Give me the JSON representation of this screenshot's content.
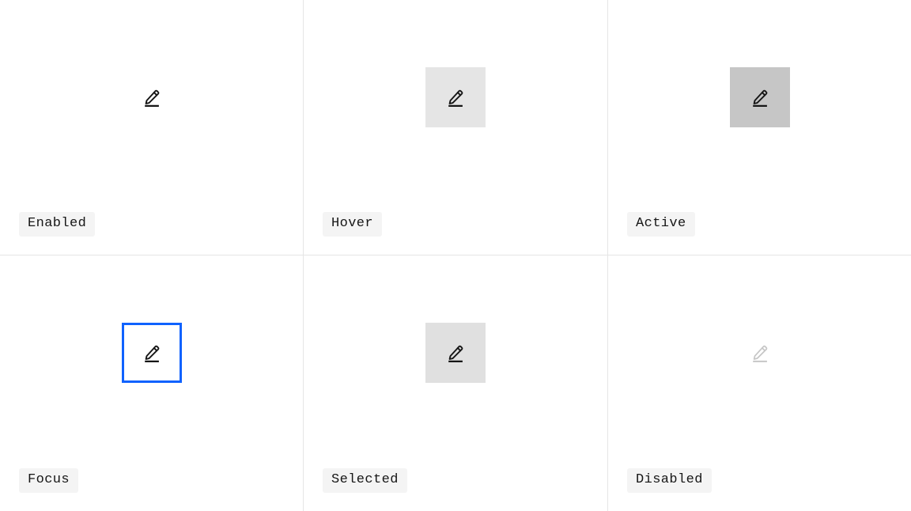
{
  "page": {
    "title": "Icon Button States",
    "background": "#ffffff",
    "grid_line_color": "#e5e5e5",
    "columns": 3,
    "rows": 2
  },
  "tokens": {
    "icon_color": "#161616",
    "icon_color_disabled": "#c6c6c6",
    "hover_background": "#e5e5e5",
    "active_background": "#c6c6c6",
    "selected_background": "#e0e0e0",
    "focus_border": "#0f62fe",
    "chip_background": "#f4f4f4",
    "chip_text": "#161616"
  },
  "cells": [
    {
      "id": "enabled",
      "label": "Enabled",
      "icon": "edit-pencil-icon",
      "state": "enabled",
      "background": "transparent",
      "has_focus_ring": false,
      "has_cursor": false,
      "icon_color": "#161616"
    },
    {
      "id": "hover",
      "label": "Hover",
      "icon": "edit-pencil-icon",
      "state": "hover",
      "background": "#e5e5e5",
      "has_focus_ring": false,
      "has_cursor": true,
      "cursor_type": "pointer-hand-cursor",
      "icon_color": "#161616"
    },
    {
      "id": "active",
      "label": "Active",
      "icon": "edit-pencil-icon",
      "state": "active",
      "background": "#c6c6c6",
      "has_focus_ring": false,
      "has_cursor": false,
      "icon_color": "#161616"
    },
    {
      "id": "focus",
      "label": "Focus",
      "icon": "edit-pencil-icon",
      "state": "focus",
      "background": "#ffffff",
      "has_focus_ring": true,
      "focus_ring_color": "#0f62fe",
      "has_cursor": false,
      "icon_color": "#161616"
    },
    {
      "id": "selected",
      "label": "Selected",
      "icon": "edit-pencil-icon",
      "state": "selected",
      "background": "#e0e0e0",
      "has_focus_ring": false,
      "has_cursor": false,
      "icon_color": "#161616"
    },
    {
      "id": "disabled",
      "label": "Disabled",
      "icon": "edit-pencil-icon",
      "state": "disabled",
      "background": "transparent",
      "has_focus_ring": false,
      "has_cursor": false,
      "icon_color": "#c6c6c6"
    }
  ]
}
